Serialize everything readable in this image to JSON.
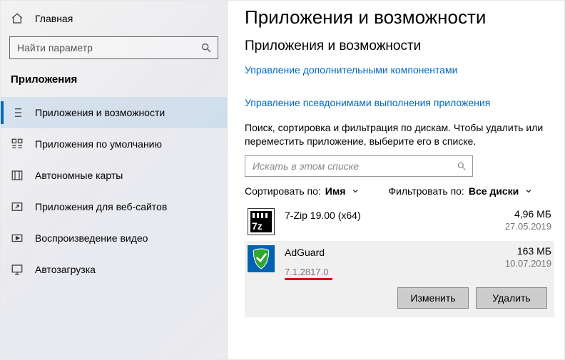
{
  "sidebar": {
    "home_label": "Главная",
    "search_placeholder": "Найти параметр",
    "section_title": "Приложения",
    "items": [
      {
        "label": "Приложения и возможности",
        "selected": true
      },
      {
        "label": "Приложения по умолчанию"
      },
      {
        "label": "Автономные карты"
      },
      {
        "label": "Приложения для веб-сайтов"
      },
      {
        "label": "Воспроизведение видео"
      },
      {
        "label": "Автозагрузка"
      }
    ]
  },
  "main": {
    "page_title": "Приложения и возможности",
    "section_head": "Приложения и возможности",
    "link_optional": "Управление дополнительными компонентами",
    "link_aliases": "Управление псевдонимами выполнения приложения",
    "description": "Поиск, сортировка и фильтрация по дискам. Чтобы удалить или переместить приложение, выберите его в списке.",
    "list_search_placeholder": "Искать в этом списке",
    "sort_label": "Сортировать по:",
    "sort_value": "Имя",
    "filter_label": "Фильтровать по:",
    "filter_value": "Все диски",
    "apps": [
      {
        "name": "7-Zip 19.00 (x64)",
        "size": "4,96 МБ",
        "date": "27.05.2019"
      },
      {
        "name": "AdGuard",
        "version": "7.1.2817.0",
        "size": "163 МБ",
        "date": "10.07.2019",
        "selected": true
      }
    ],
    "actions": {
      "modify": "Изменить",
      "uninstall": "Удалить"
    }
  }
}
